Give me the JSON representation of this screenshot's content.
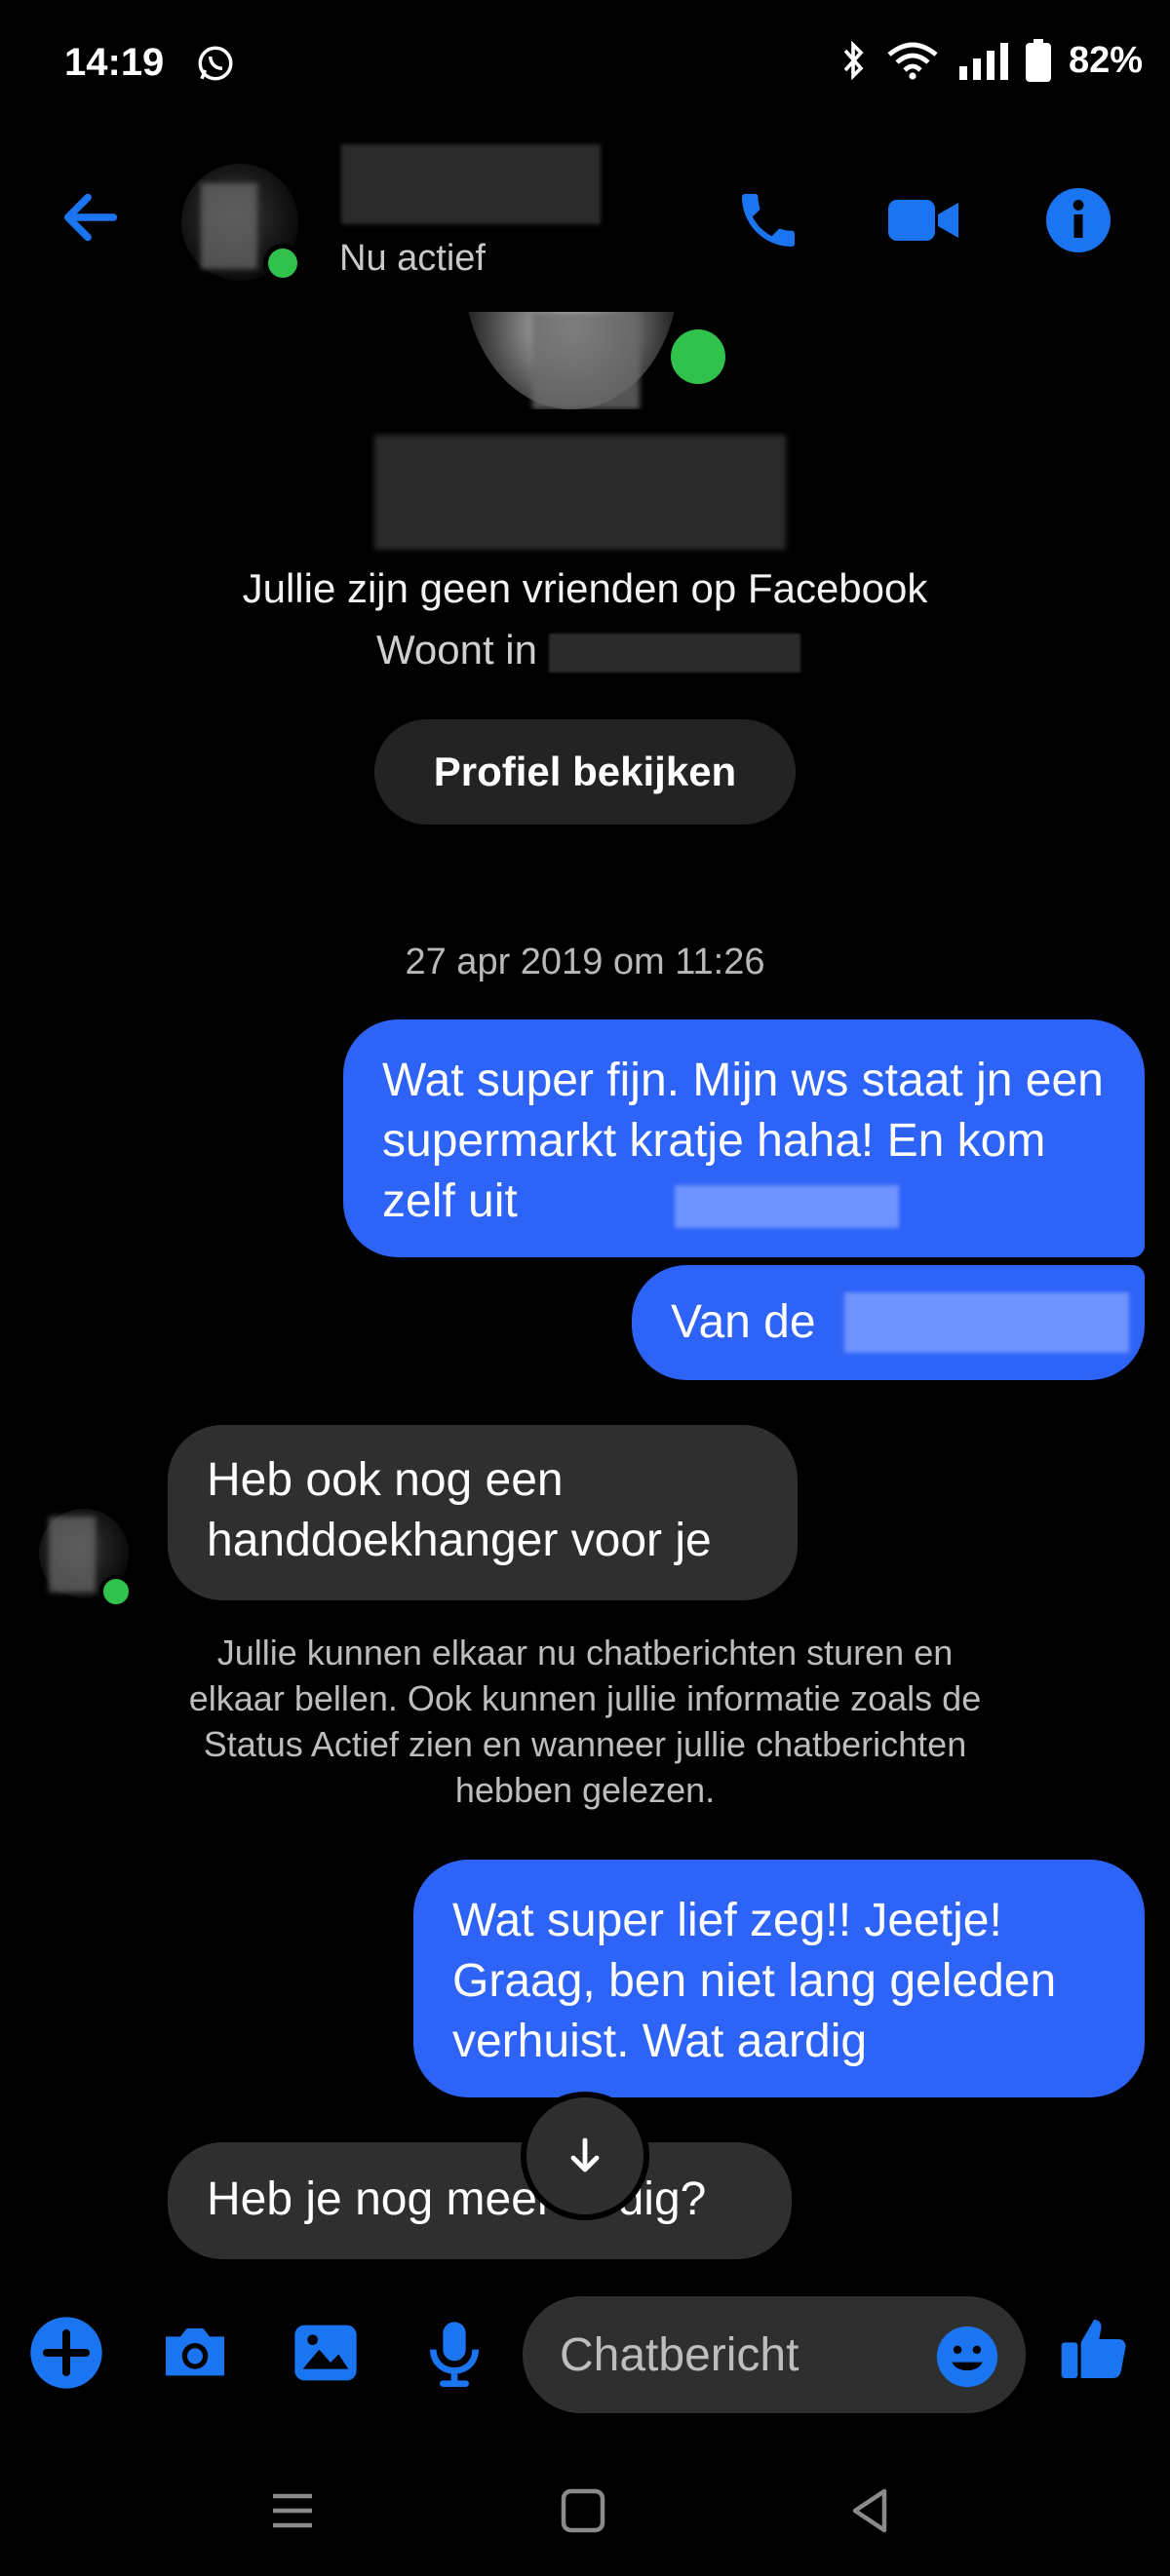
{
  "status_bar": {
    "time": "14:19",
    "battery": "82%",
    "icons": [
      "whatsapp-icon",
      "bluetooth-icon",
      "wifi-icon",
      "signal-icon",
      "battery-icon"
    ]
  },
  "header": {
    "status": "Nu actief",
    "icons": [
      "back-arrow-icon",
      "phone-icon",
      "video-icon",
      "info-icon"
    ]
  },
  "profile": {
    "friends_text": "Jullie zijn geen vrienden op Facebook",
    "lives_label": "Woont in",
    "view_profile": "Profiel bekijken"
  },
  "conversation": {
    "date": "27 apr 2019 om 11:26",
    "messages": [
      {
        "from": "me",
        "text": "Wat super fijn. Mijn ws staat jn een supermarkt kratje haha!  En kom zelf uit"
      },
      {
        "from": "me",
        "text": "Van de"
      },
      {
        "from": "them",
        "text": "Heb ook nog een handdoekhanger voor je"
      },
      {
        "from": "me",
        "text": "Wat super lief zeg!! Jeetje! Graag, ben niet lang geleden verhuist. Wat aardig"
      },
      {
        "from": "them",
        "text": "Heb je nog meer nodig?"
      }
    ],
    "system_notice": "Jullie kunnen elkaar nu chatberichten sturen en elkaar bellen. Ook kunnen jullie informatie zoals de Status Actief zien en wanneer jullie chatberichten hebben gelezen."
  },
  "composer": {
    "placeholder": "Chatbericht",
    "icons": [
      "plus-icon",
      "camera-icon",
      "gallery-icon",
      "mic-icon",
      "emoji-icon",
      "thumbs-up-icon"
    ]
  },
  "colors": {
    "accent": "#2d63f7",
    "icon_blue": "#1b74f0",
    "received_bubble": "#2f2f2f",
    "online": "#31c24d"
  }
}
